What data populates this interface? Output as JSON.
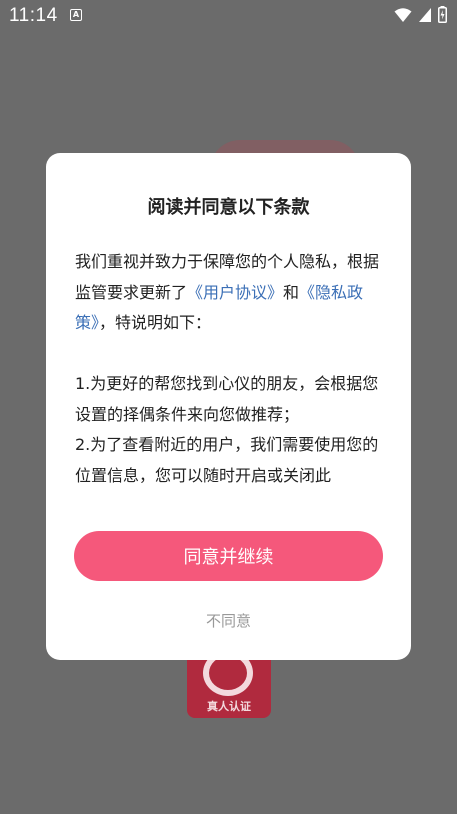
{
  "status_bar": {
    "time": "11:14",
    "notification_icon": "A"
  },
  "background": {
    "badge_label": "真人认证"
  },
  "dialog": {
    "title": "阅读并同意以下条款",
    "para1_text1": "我们重视并致力于保障您的个人隐私，根据监管要求更新了",
    "link_user_agreement": "《用户协议》",
    "para1_and": "和",
    "link_privacy_policy": "《隐私政策》",
    "para1_text2": "，特说明如下：",
    "item1": "1.为更好的帮您找到心仪的朋友，会根据您设置的择偶条件来向您做推荐；",
    "item2": "2.为了查看附近的用户，我们需要使用您的位置信息，您可以随时开启或关闭此",
    "agree_label": "同意并继续",
    "disagree_label": "不同意"
  },
  "colors": {
    "accent": "#f5587b",
    "link": "#3b6fb6",
    "overlay": "#6b6b6b"
  }
}
